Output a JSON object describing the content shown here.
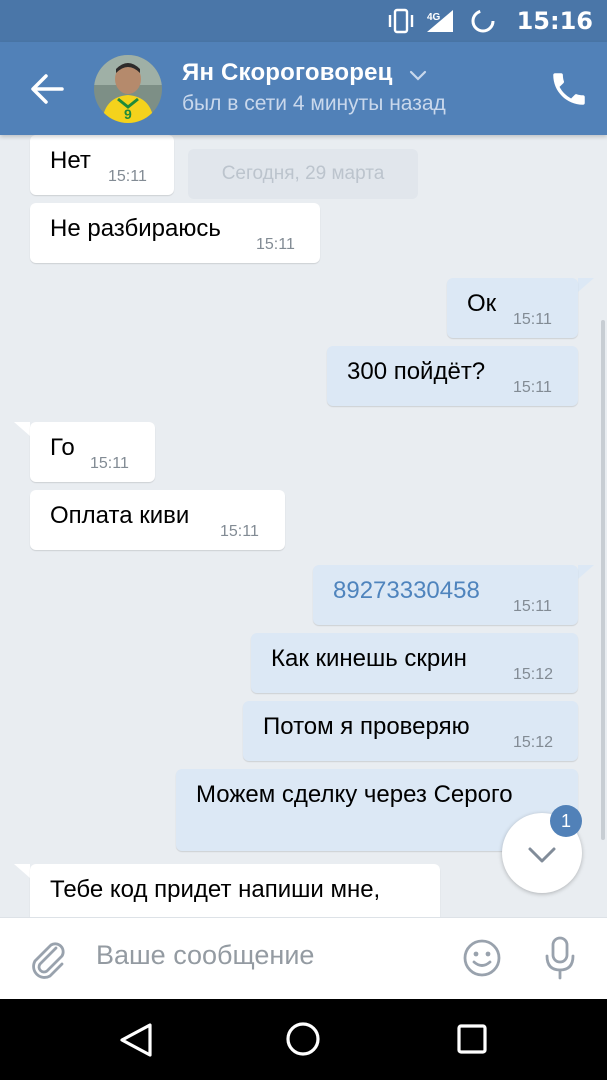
{
  "status_bar": {
    "time": "15:16",
    "network": "4G"
  },
  "header": {
    "contact_name": "Ян Скороговорец",
    "contact_status": "был в сети 4 минуты назад"
  },
  "date_separator": "Сегодня, 29 марта",
  "messages": [
    {
      "direction": "in",
      "text": "Нет",
      "time": "15:11"
    },
    {
      "direction": "in",
      "text": "Не разбираюсь",
      "time": "15:11"
    },
    {
      "direction": "out",
      "text": "Ок",
      "time": "15:11"
    },
    {
      "direction": "out",
      "text": "300 пойдёт?",
      "time": "15:11"
    },
    {
      "direction": "in",
      "text": "Го",
      "time": "15:11"
    },
    {
      "direction": "in",
      "text": "Оплата киви",
      "time": "15:11"
    },
    {
      "direction": "out",
      "text": "89273330458",
      "time": "15:11"
    },
    {
      "direction": "out",
      "text": "Как кинешь скрин",
      "time": "15:12"
    },
    {
      "direction": "out",
      "text": "Потом я проверяю",
      "time": "15:12"
    },
    {
      "direction": "out",
      "text": "Можем сделку через Серого",
      "time": ""
    },
    {
      "direction": "in",
      "text": "Тебе код придет напиши мне,",
      "time": ""
    }
  ],
  "scroll_down": {
    "badge": "1"
  },
  "composer": {
    "placeholder": "Ваше сообщение"
  },
  "colors": {
    "header": "#5181b8",
    "status_bar": "#4a76a8",
    "incoming": "#ffffff",
    "outgoing": "#dce8f5",
    "link": "#4f84bd"
  }
}
